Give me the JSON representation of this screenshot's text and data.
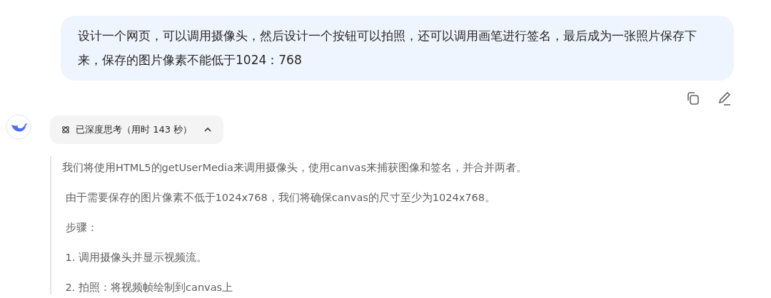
{
  "user_message": {
    "text": "设计一个网页，可以调用摄像头，然后设计一个按钮可以拍照，还可以调用画笔进行签名，最后成为一张照片保存下来，保存的图片像素不能低于1024：768"
  },
  "thinking": {
    "label": "已深度思考（用时 143 秒）",
    "expanded": true,
    "lines": [
      "我们将使用HTML5的getUserMedia来调用摄像头，使用canvas来捕获图像和签名，并合并两者。",
      " 由于需要保存的图片像素不低于1024x768，我们将确保canvas的尺寸至少为1024x768。",
      " 步骤：",
      " 1. 调用摄像头并显示视频流。",
      " 2. 拍照：将视频帧绘制到canvas上"
    ]
  }
}
